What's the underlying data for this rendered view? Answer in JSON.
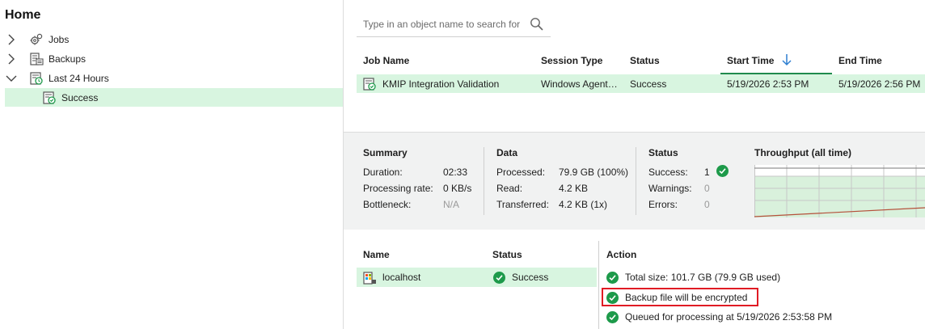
{
  "nav": {
    "title": "Home",
    "items": [
      {
        "label": "Jobs",
        "expander": "collapsed",
        "icon": "jobs-gear-icon"
      },
      {
        "label": "Backups",
        "expander": "collapsed",
        "icon": "backups-icon"
      },
      {
        "label": "Last 24 Hours",
        "expander": "expanded",
        "icon": "last24-icon"
      },
      {
        "label": "Success",
        "expander": "none",
        "icon": "success-session-icon",
        "selected": true
      }
    ]
  },
  "search": {
    "placeholder": "Type in an object name to search for"
  },
  "jobs_table": {
    "columns": [
      "Job Name",
      "Session Type",
      "Status",
      "Start Time",
      "End Time"
    ],
    "sort_column": "Start Time",
    "sort_direction": "descending",
    "rows": [
      {
        "job_name": "KMIP Integration Validation",
        "session_type": "Windows Agent…",
        "status": "Success",
        "start_time": "5/19/2026 2:53 PM",
        "end_time": "5/19/2026 2:56 PM",
        "selected": true
      }
    ]
  },
  "summary": {
    "summary_header": "Summary",
    "duration_label": "Duration:",
    "duration_value": "02:33",
    "rate_label": "Processing rate:",
    "rate_value": "0 KB/s",
    "bottleneck_label": "Bottleneck:",
    "bottleneck_value": "N/A",
    "data_header": "Data",
    "processed_label": "Processed:",
    "processed_value": "79.9 GB (100%)",
    "read_label": "Read:",
    "read_value": "4.2 KB",
    "transferred_label": "Transferred:",
    "transferred_value": "4.2 KB (1x)",
    "status_header": "Status",
    "success_label": "Success:",
    "success_value": "1",
    "warnings_label": "Warnings:",
    "warnings_value": "0",
    "errors_label": "Errors:",
    "errors_value": "0",
    "throughput_header": "Throughput (all time)"
  },
  "objects_table": {
    "columns": [
      "Name",
      "Status",
      "Action"
    ],
    "rows": [
      {
        "name": "localhost",
        "status": "Success",
        "selected": true
      }
    ],
    "actions": [
      {
        "text": "Total size: 101.7 GB (79.9 GB used)",
        "status": "success"
      },
      {
        "text": "Backup file will be encrypted",
        "status": "success",
        "highlighted": true
      },
      {
        "text": "Queued for processing at 5/19/2026 2:53:58 PM",
        "status": "success"
      }
    ]
  },
  "colors": {
    "selection": "#d8f5e0",
    "success_green": "#1d9a4a",
    "sort_arrow": "#2f7fd1",
    "highlight_red": "#e01b24",
    "panel_bg": "#f1f2f2"
  }
}
